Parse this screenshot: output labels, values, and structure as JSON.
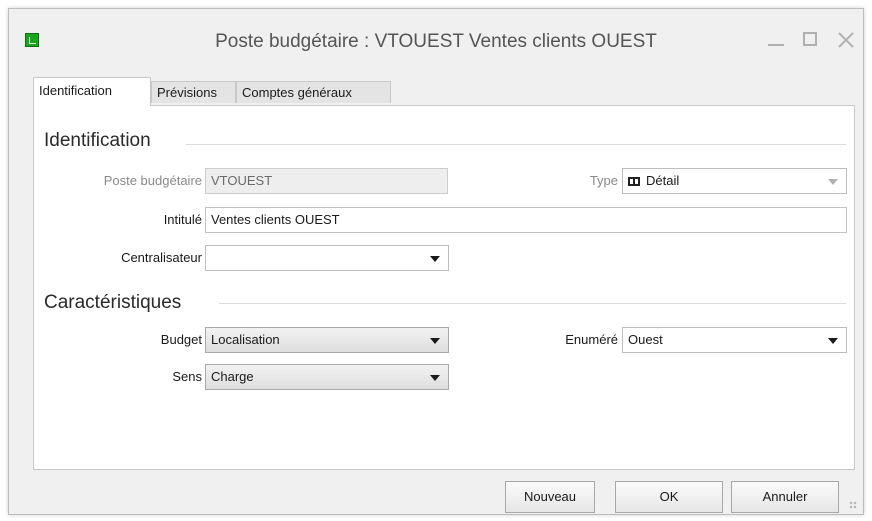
{
  "window": {
    "title": "Poste budgétaire : VTOUEST Ventes clients OUEST",
    "icon": "budget-app-icon"
  },
  "tabs": [
    {
      "label": "Identification",
      "active": true
    },
    {
      "label": "Prévisions",
      "active": false
    },
    {
      "label": "Comptes généraux",
      "active": false
    }
  ],
  "identification": {
    "section_title": "Identification",
    "poste_label": "Poste budgétaire",
    "poste_value": "VTOUEST",
    "type_label": "Type",
    "type_value": "Détail",
    "intitule_label": "Intitulé",
    "intitule_value": "Ventes clients OUEST",
    "centralisateur_label": "Centralisateur",
    "centralisateur_value": ""
  },
  "caracteristiques": {
    "section_title": "Caractéristiques",
    "budget_label": "Budget",
    "budget_value": "Localisation",
    "enumere_label": "Enuméré",
    "enumere_value": "Ouest",
    "sens_label": "Sens",
    "sens_value": "Charge"
  },
  "footer": {
    "nouveau_label": "Nouveau",
    "ok_label": "OK",
    "annuler_label": "Annuler"
  },
  "colors": {
    "window_bg": "#f0f0f0",
    "panel_bg": "#ffffff",
    "app_icon": "#19a51c",
    "disabled_text": "#8a8a8a"
  }
}
